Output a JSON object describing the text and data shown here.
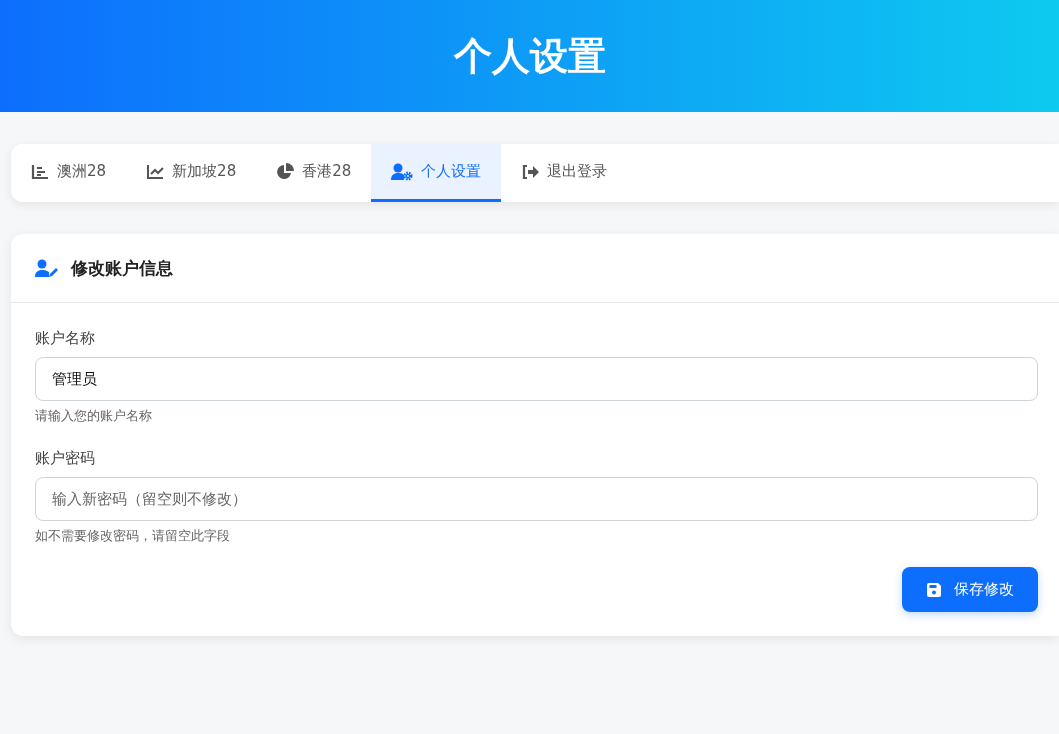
{
  "header": {
    "title": "个人设置"
  },
  "tabs": [
    {
      "label": "澳洲28",
      "kind": "bar-chart",
      "selected": false
    },
    {
      "label": "新加坡28",
      "kind": "line-chart",
      "selected": false
    },
    {
      "label": "香港28",
      "kind": "pie-chart",
      "selected": false
    },
    {
      "label": "个人设置",
      "kind": "user-settings",
      "selected": true
    },
    {
      "label": "退出登录",
      "kind": "logout",
      "selected": false
    }
  ],
  "card": {
    "title": "修改账户信息",
    "fields": [
      {
        "label": "账户名称",
        "value": "管理员",
        "help": "请输入您的账户名称"
      },
      {
        "label": "账户密码",
        "placeholder": "输入新密码（留空则不修改）",
        "help": "如不需要修改密码，请留空此字段"
      }
    ],
    "button": "保存修改"
  }
}
